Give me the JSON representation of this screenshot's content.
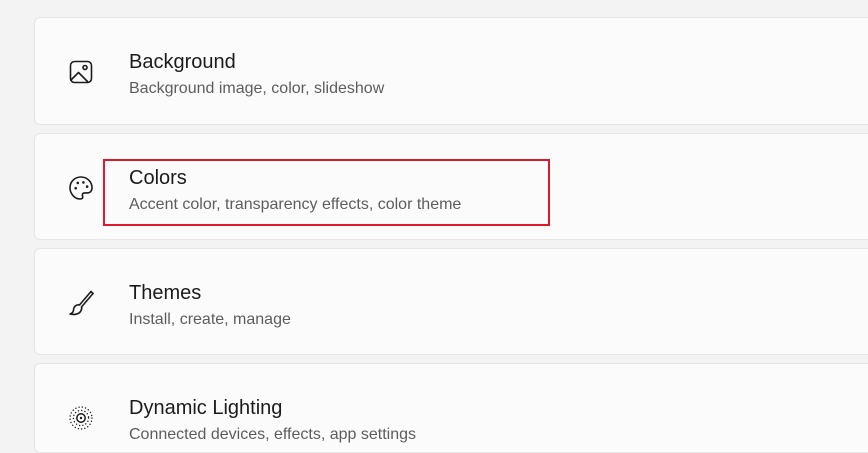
{
  "settings_items": [
    {
      "title": "Background",
      "subtitle": "Background image, color, slideshow",
      "icon": "image-icon"
    },
    {
      "title": "Colors",
      "subtitle": "Accent color, transparency effects, color theme",
      "icon": "palette-icon"
    },
    {
      "title": "Themes",
      "subtitle": "Install, create, manage",
      "icon": "brush-icon"
    },
    {
      "title": "Dynamic Lighting",
      "subtitle": "Connected devices, effects, app settings",
      "icon": "dynamic-lighting-icon"
    }
  ],
  "highlight_color": "#e0182d"
}
